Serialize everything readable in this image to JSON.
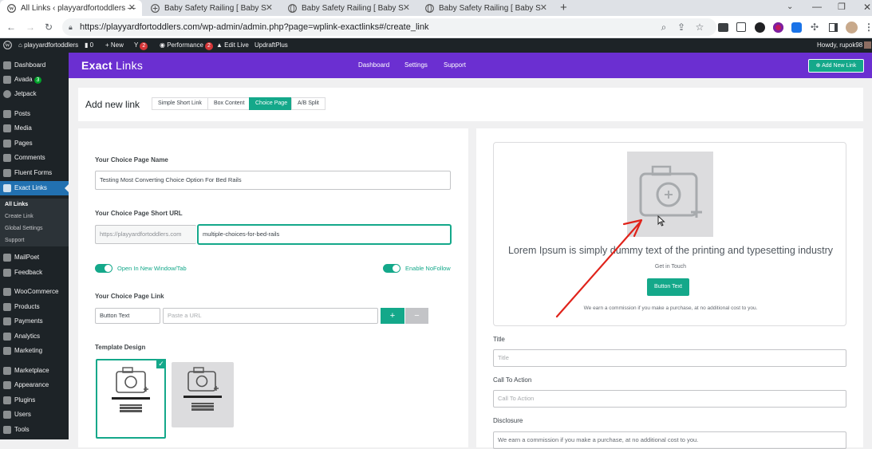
{
  "browser": {
    "tabs": [
      {
        "title": "All Links ‹ playyardfortoddlers —",
        "active": true
      },
      {
        "title": "Baby Safety Railing [ Baby Safety",
        "active": false
      },
      {
        "title": "Baby Safety Railing [ Baby Safety",
        "active": false
      },
      {
        "title": "Baby Safety Railing [ Baby Safety",
        "active": false
      }
    ],
    "new_tab": "+",
    "url": "https://playyardfortoddlers.com/wp-admin/admin.php?page=wplink-exactlinks#/create_link"
  },
  "adminbar": {
    "site": "playyardfortoddlers",
    "comments": "0",
    "new": "+ New",
    "yoast_count": "2",
    "performance": "Performance",
    "performance_count": "2",
    "edit_live": "Edit Live",
    "updraft": "UpdraftPlus",
    "howdy": "Howdy, rupok98"
  },
  "sidebar": {
    "items": [
      {
        "label": "Dashboard",
        "icon": "dashboard-icon"
      },
      {
        "label": "Avada",
        "badge": "3",
        "icon": "avada-icon"
      },
      {
        "label": "Jetpack",
        "icon": "jetpack-icon"
      },
      {
        "label": "Posts",
        "icon": "pin-icon"
      },
      {
        "label": "Media",
        "icon": "media-icon"
      },
      {
        "label": "Pages",
        "icon": "page-icon"
      },
      {
        "label": "Comments",
        "icon": "comment-icon"
      },
      {
        "label": "Fluent Forms",
        "icon": "form-icon"
      },
      {
        "label": "Exact Links",
        "icon": "link-icon",
        "current": true
      }
    ],
    "submenu": [
      "All Links",
      "Create Link",
      "Global Settings",
      "Support"
    ],
    "items2": [
      {
        "label": "MailPoet",
        "icon": "mail-icon"
      },
      {
        "label": "Feedback",
        "icon": "feedback-icon"
      },
      {
        "label": "WooCommerce",
        "icon": "woo-icon"
      },
      {
        "label": "Products",
        "icon": "products-icon"
      },
      {
        "label": "Payments",
        "icon": "payments-icon"
      },
      {
        "label": "Analytics",
        "icon": "analytics-icon"
      },
      {
        "label": "Marketing",
        "icon": "marketing-icon"
      },
      {
        "label": "Marketplace",
        "icon": "marketplace-icon"
      },
      {
        "label": "Appearance",
        "icon": "brush-icon"
      },
      {
        "label": "Plugins",
        "icon": "plugin-icon"
      },
      {
        "label": "Users",
        "icon": "users-icon"
      },
      {
        "label": "Tools",
        "icon": "tools-icon"
      }
    ]
  },
  "plugin": {
    "logo_bold": "Exact",
    "logo_rest": " Links",
    "nav": [
      "Dashboard",
      "Settings",
      "Support"
    ],
    "add_new": "Add New Link"
  },
  "page": {
    "title": "Add new link",
    "type_tabs": [
      "Simple Short Link",
      "Box Content",
      "Choice Page",
      "A/B Split"
    ],
    "active_tab": "Choice Page"
  },
  "form": {
    "name_label": "Your Choice Page Name",
    "name_value": "Testing Most Converting Choice Option For Bed Rails",
    "url_label": "Your Choice Page Short URL",
    "url_prefix": "https://playyardfortoddlers.com",
    "url_slug": "multiple-choices-for-bed-rails",
    "toggle_new_window": "Open In New Window/Tab",
    "toggle_nofollow": "Enable NoFollow",
    "link_label": "Your Choice Page Link",
    "button_text_value": "Button Text",
    "url_placeholder": "Paste a URL",
    "add_btn": "+",
    "remove_btn": "−",
    "template_label": "Template Design"
  },
  "preview": {
    "headline": "Lorem Ipsum is simply dummy text of the printing and typesetting industry",
    "subtext": "Get in Touch",
    "button": "Button Text",
    "disclosure": "We earn a commission if you make a purchase, at no additional cost to you.",
    "title_label": "Title",
    "title_placeholder": "Title",
    "cta_label": "Call To Action",
    "cta_placeholder": "Call To Action",
    "disclosure_label": "Disclosure",
    "disclosure_value": "We earn a commission if you make a purchase, at no additional cost to you."
  },
  "colors": {
    "accent": "#14a88a",
    "brand": "#6b2fd1",
    "wp_dark": "#1d2327",
    "annotation": "#e0231b"
  }
}
